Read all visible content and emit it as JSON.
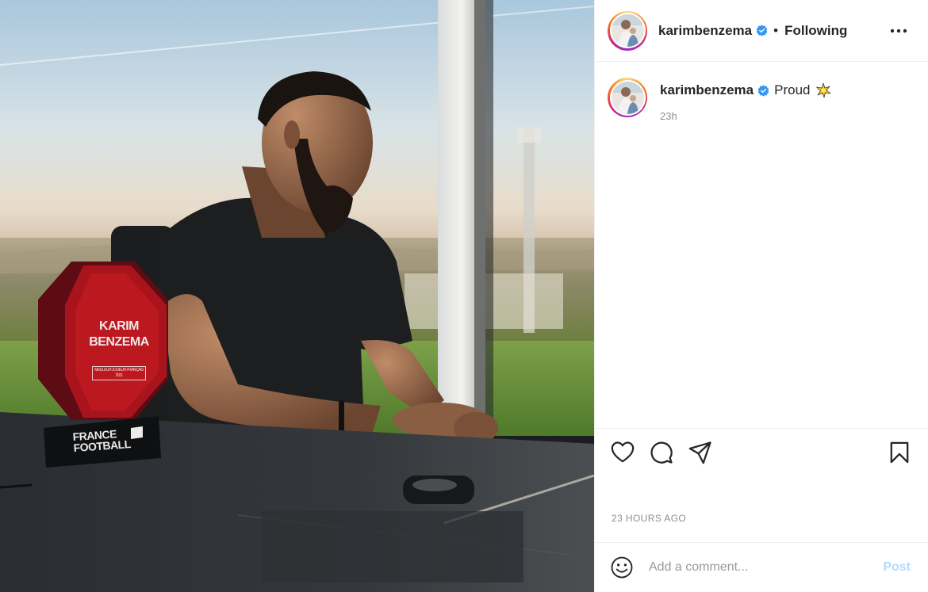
{
  "post": {
    "photo": {
      "trophy_name": "KARIM BENZEMA",
      "trophy_award": "MEILLEUR JOUEUR FRANÇAIS 2021",
      "base_brand": "FRANCE FOOTBALL"
    },
    "header": {
      "username": "karimbenzema",
      "verified": true,
      "separator": "•",
      "follow_state": "Following",
      "more_icon": "more-horizontal-icon"
    },
    "caption": {
      "username": "karimbenzema",
      "text": "Proud",
      "emoji": "sparkle-emoji",
      "time": "23h"
    },
    "actions": {
      "like_icon": "heart-icon",
      "comment_icon": "comment-icon",
      "share_icon": "share-icon",
      "save_icon": "bookmark-icon"
    },
    "timestamp": "23 HOURS AGO",
    "comment": {
      "placeholder": "Add a comment...",
      "post_label": "Post"
    },
    "colors": {
      "verified_blue": "#3897f0",
      "post_button_disabled": "#b3dbff",
      "secondary_text": "#8e8e8e"
    }
  }
}
